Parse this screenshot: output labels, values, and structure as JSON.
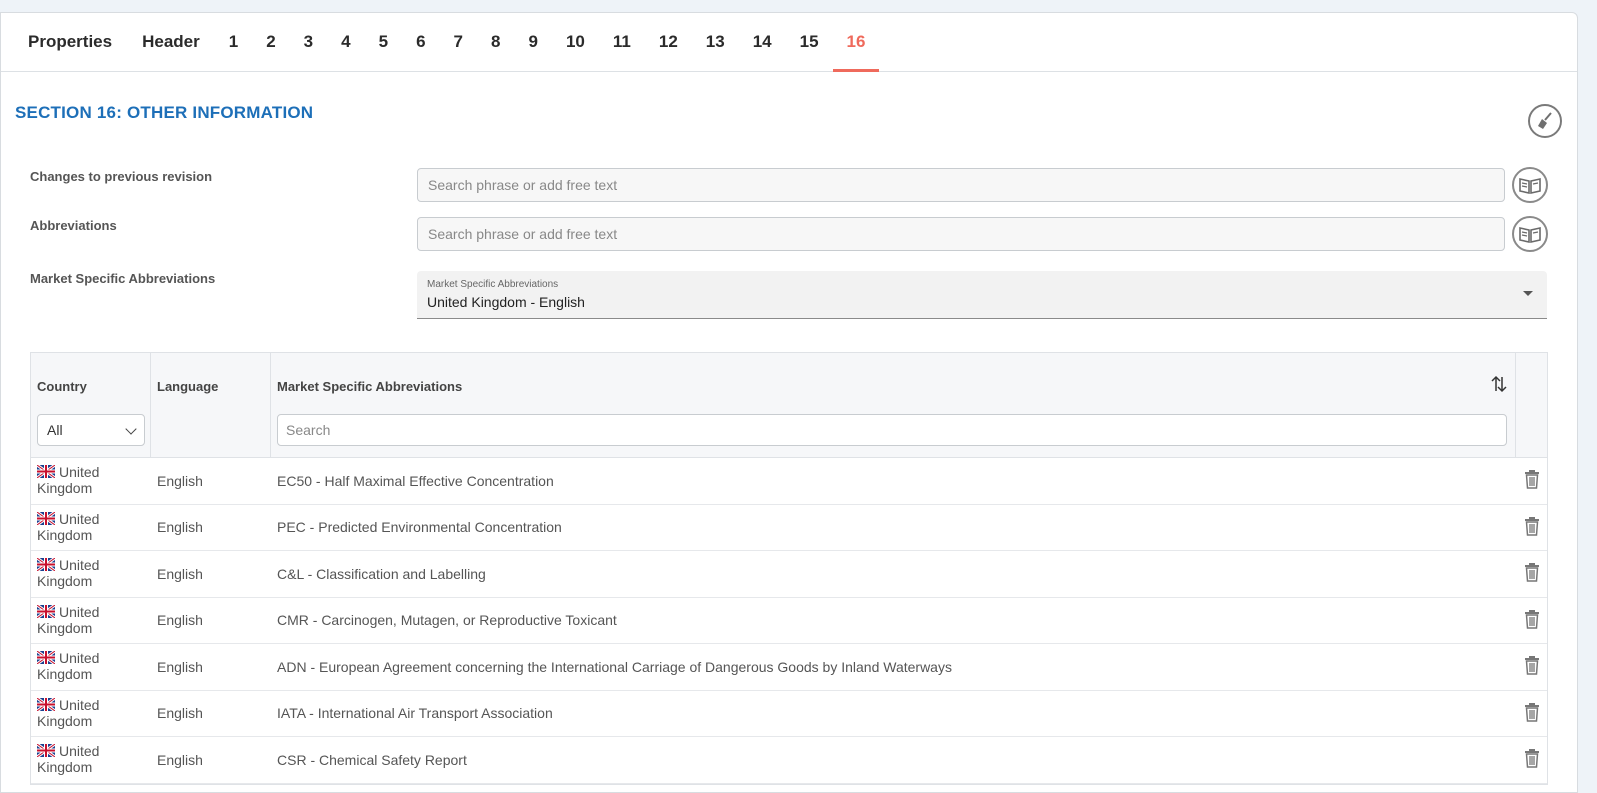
{
  "tabs": [
    {
      "label": "Properties"
    },
    {
      "label": "Header"
    },
    {
      "label": "1"
    },
    {
      "label": "2"
    },
    {
      "label": "3"
    },
    {
      "label": "4"
    },
    {
      "label": "5"
    },
    {
      "label": "6"
    },
    {
      "label": "7"
    },
    {
      "label": "8"
    },
    {
      "label": "9"
    },
    {
      "label": "10"
    },
    {
      "label": "11"
    },
    {
      "label": "12"
    },
    {
      "label": "13"
    },
    {
      "label": "14"
    },
    {
      "label": "15"
    },
    {
      "label": "16",
      "active": true
    }
  ],
  "section": {
    "title": "SECTION 16: OTHER INFORMATION"
  },
  "form": {
    "changes_label": "Changes to previous revision",
    "changes_placeholder": "Search phrase or add free text",
    "abbreviations_label": "Abbreviations",
    "abbreviations_placeholder": "Search phrase or add free text",
    "market_label": "Market Specific Abbreviations",
    "market_select_label": "Market Specific Abbreviations",
    "market_select_value": "United Kingdom - English"
  },
  "table": {
    "headers": {
      "country": "Country",
      "language": "Language",
      "abbreviations": "Market Specific Abbreviations"
    },
    "country_filter": "All",
    "search_placeholder": "Search",
    "rows": [
      {
        "country_line1": "United",
        "country_line2": "Kingdom",
        "language": "English",
        "text": "EC50 - Half Maximal Effective Concentration"
      },
      {
        "country_line1": "United",
        "country_line2": "Kingdom",
        "language": "English",
        "text": "PEC - Predicted Environmental Concentration"
      },
      {
        "country_line1": "United",
        "country_line2": "Kingdom",
        "language": "English",
        "text": "C&L - Classification and Labelling"
      },
      {
        "country_line1": "United",
        "country_line2": "Kingdom",
        "language": "English",
        "text": "CMR - Carcinogen, Mutagen, or Reproductive Toxicant"
      },
      {
        "country_line1": "United",
        "country_line2": "Kingdom",
        "language": "English",
        "text": "ADN - European Agreement concerning the International Carriage of Dangerous Goods by Inland Waterways"
      },
      {
        "country_line1": "United",
        "country_line2": "Kingdom",
        "language": "English",
        "text": "IATA - International Air Transport Association"
      },
      {
        "country_line1": "United",
        "country_line2": "Kingdom",
        "language": "English",
        "text": "CSR - Chemical Safety Report"
      }
    ]
  },
  "colors": {
    "accent": "#ef6a5c",
    "title_blue": "#1d6fb8"
  },
  "icons": {
    "clear": "broom-icon",
    "phrase_library": "book-icon",
    "sort": "sort-icon",
    "delete": "trash-icon",
    "flag": "uk-flag-icon"
  }
}
